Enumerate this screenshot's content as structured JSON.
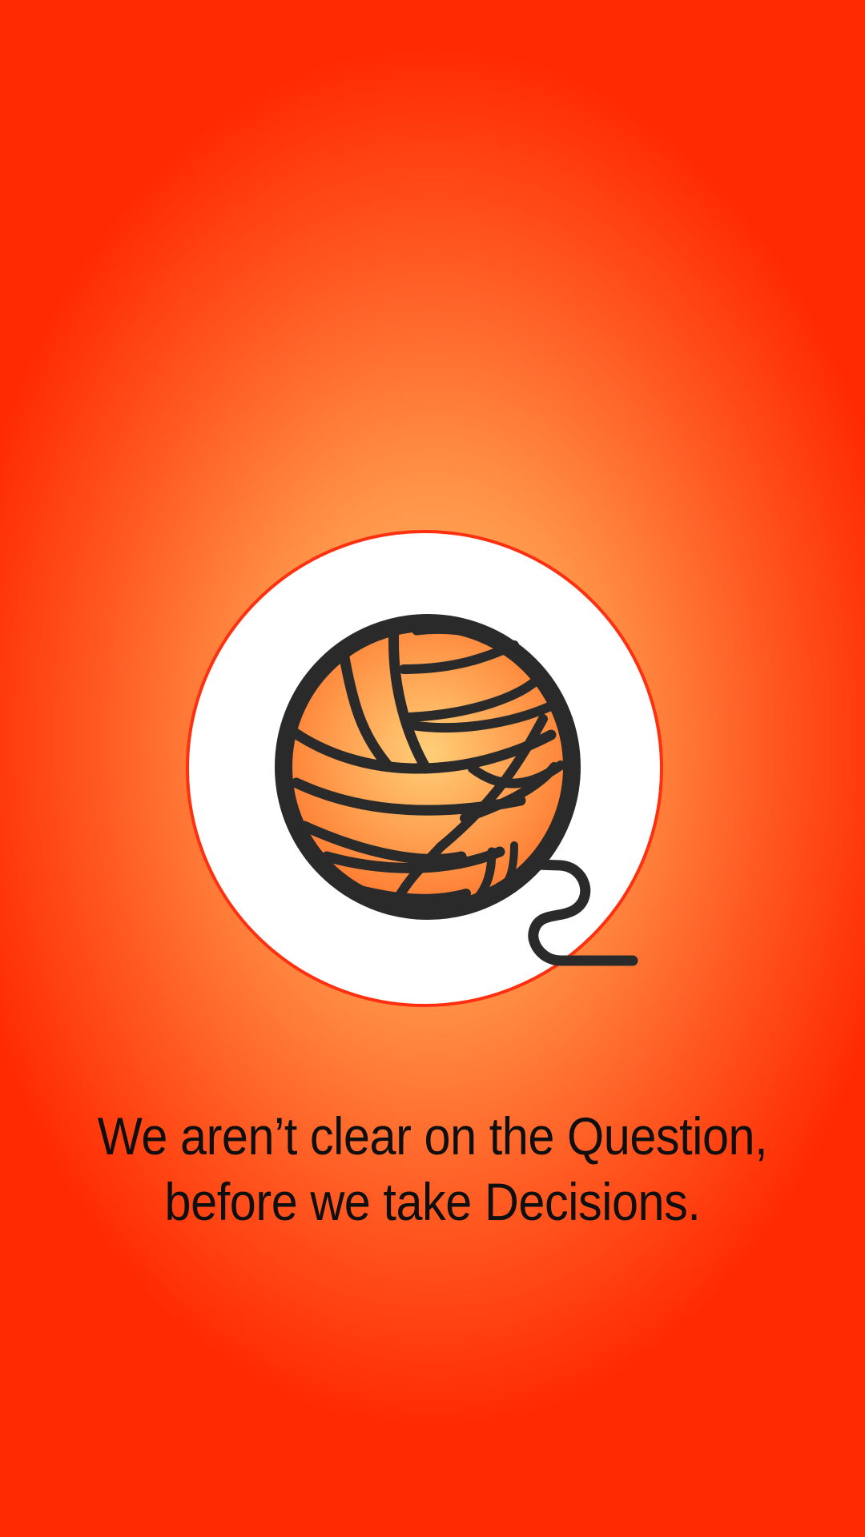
{
  "splash": {
    "logo_icon": "yarn-ball-q-icon",
    "tagline": {
      "line1": "We aren’t clear on the Question,",
      "line2": "before we take Decisions."
    },
    "colors": {
      "background_outer": "#ff2a02",
      "background_center": "#ffc56e",
      "circle_fill": "#ffffff",
      "circle_stroke": "#ff3010",
      "yarn_stroke": "#2a2a2a"
    }
  }
}
